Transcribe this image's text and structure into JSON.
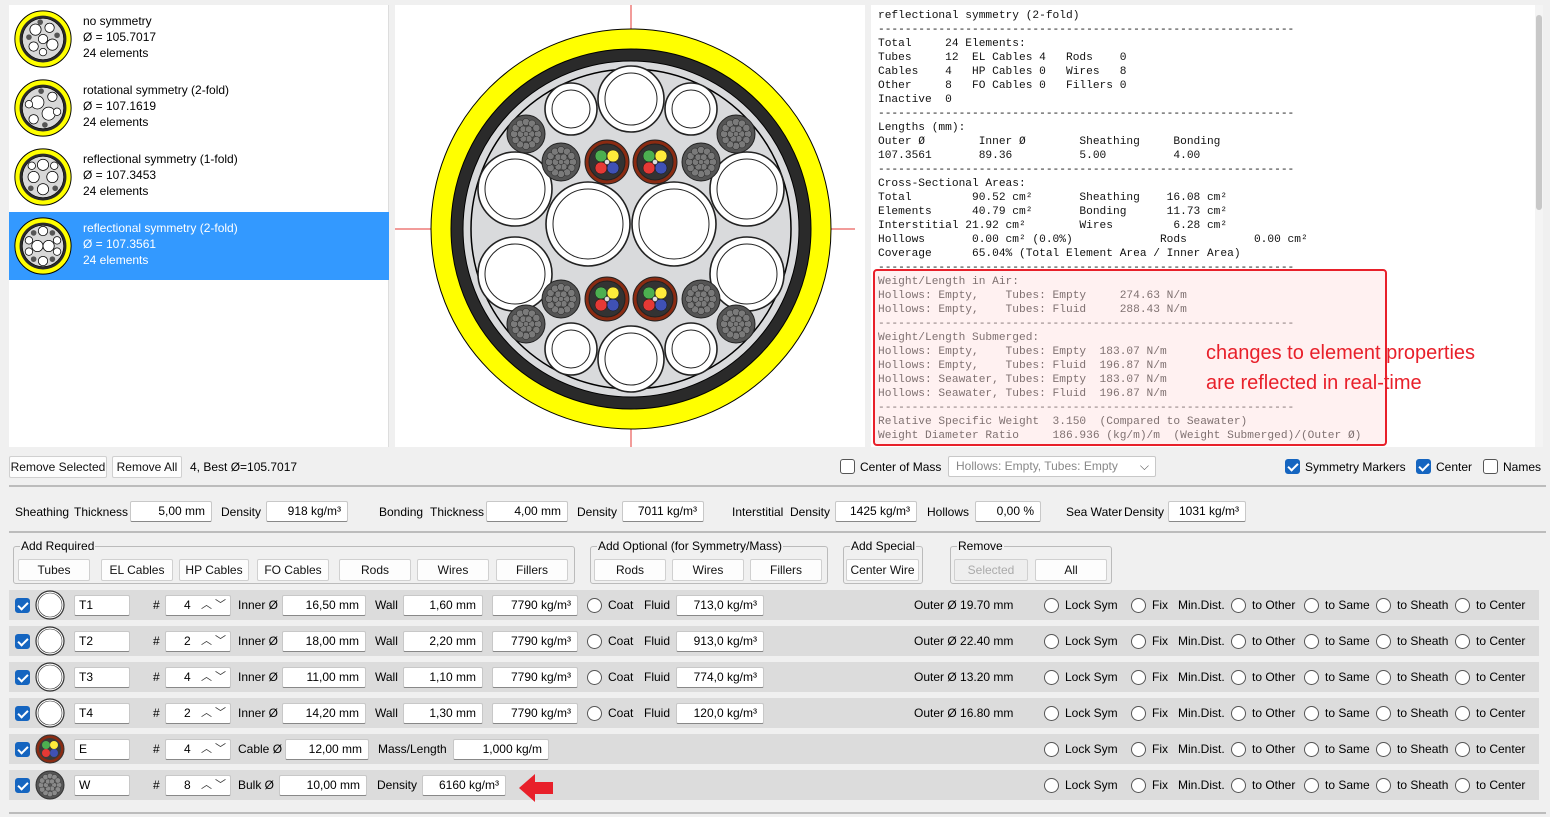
{
  "designs": [
    {
      "name": "no symmetry",
      "diameter": "Ø = 105.7017",
      "count": "24 elements"
    },
    {
      "name": "rotational symmetry (2-fold)",
      "diameter": "Ø = 107.1619",
      "count": "24 elements"
    },
    {
      "name": "reflectional symmetry (1-fold)",
      "diameter": "Ø = 107.3453",
      "count": "24 elements"
    },
    {
      "name": "reflectional symmetry (2-fold)",
      "diameter": "Ø = 107.3561",
      "count": "24 elements",
      "selected": true
    }
  ],
  "report": {
    "text": "reflectional symmetry (2-fold)\n--------------------------------------------------------------\nTotal     24 Elements:\nTubes     12  EL Cables 4   Rods    0\nCables    4   HP Cables 0   Wires   8\nOther     8   FO Cables 0   Fillers 0\nInactive  0\n--------------------------------------------------------------\nLengths (mm):\nOuter Ø        Inner Ø        Sheathing     Bonding\n107.3561       89.36          5.00          4.00\n--------------------------------------------------------------\nCross-Sectional Areas:\nTotal         90.52 cm²       Sheathing    16.08 cm²\nElements      40.79 cm²       Bonding      11.73 cm²\nInterstitial 21.92 cm²        Wires         6.28 cm²\nHollows       0.00 cm² (0.0%)             Rods          0.00 cm²\nCoverage      65.04% (Total Element Area / Inner Area)\n--------------------------------------------------------------\nWeight/Length in Air:\nHollows: Empty,    Tubes: Empty     274.63 N/m\nHollows: Empty,    Tubes: Fluid     288.43 N/m\n--------------------------------------------------------------\nWeight/Length Submerged:\nHollows: Empty,    Tubes: Empty  183.07 N/m\nHollows: Empty,    Tubes: Fluid  196.87 N/m\nHollows: Seawater, Tubes: Empty  183.07 N/m\nHollows: Seawater, Tubes: Fluid  196.87 N/m\n--------------------------------------------------------------\nRelative Specific Weight  3.150  (Compared to Seawater)\nWeight Diameter Ratio     186.936 (kg/m)/m  (Weight Submerged)/(Outer Ø)",
    "annotation_line1": "changes to element properties",
    "annotation_line2": "are reflected in real-time",
    "highlight_color": "#e8202a"
  },
  "toolbar": {
    "remove_selected": "Remove Selected",
    "remove_all": "Remove All",
    "best": "4, Best Ø=105.7017",
    "center_of_mass": "Center of Mass",
    "hollows_combo": "Hollows: Empty, Tubes: Empty",
    "symmetry_markers": "Symmetry Markers",
    "center": "Center",
    "names": "Names"
  },
  "props": {
    "sheathing": "Sheathing",
    "thickness": "Thickness",
    "sheathing_thickness": "5,00 mm",
    "density": "Density",
    "sheathing_density": "918 kg/m³",
    "bonding": "Bonding",
    "bonding_thickness": "4,00 mm",
    "bonding_density": "7011 kg/m³",
    "interstitial": "Interstitial",
    "interstitial_density": "1425 kg/m³",
    "hollows": "Hollows",
    "hollows_value": "0,00 %",
    "sea_water": "Sea Water",
    "sea_water_density": "1031 kg/m³"
  },
  "groups": {
    "required": {
      "title": "Add Required",
      "buttons": [
        "Tubes",
        "EL Cables",
        "HP Cables",
        "FO Cables",
        "Rods",
        "Wires",
        "Fillers"
      ]
    },
    "optional": {
      "title": "Add Optional (for Symmetry/Mass)",
      "buttons": [
        "Rods",
        "Wires",
        "Fillers"
      ]
    },
    "special": {
      "title": "Add Special",
      "buttons": [
        "Center Wire"
      ]
    },
    "remove": {
      "title": "Remove",
      "buttons": [
        "Selected",
        "All"
      ]
    }
  },
  "rowlabels": {
    "hash": "#",
    "inner": "Inner Ø",
    "wall": "Wall",
    "coat": "Coat",
    "fluid": "Fluid",
    "cable": "Cable Ø",
    "mass": "Mass/Length",
    "bulk": "Bulk Ø",
    "density": "Density",
    "lock": "Lock Sym",
    "fix": "Fix",
    "mindist": "Min.Dist.",
    "to_other": "to Other",
    "to_same": "to Same",
    "to_sheath": "to Sheath",
    "to_center": "to Center"
  },
  "rows": [
    {
      "name": "T1",
      "count": "4",
      "kind": "tube",
      "inner": "16,50 mm",
      "wall": "1,60 mm",
      "mat": "7790 kg/m³",
      "fluid": "713,0 kg/m³",
      "outer": "Outer Ø 19.70 mm"
    },
    {
      "name": "T2",
      "count": "2",
      "kind": "tube",
      "inner": "18,00 mm",
      "wall": "2,20 mm",
      "mat": "7790 kg/m³",
      "fluid": "913,0 kg/m³",
      "outer": "Outer Ø 22.40 mm"
    },
    {
      "name": "T3",
      "count": "4",
      "kind": "tube",
      "inner": "11,00 mm",
      "wall": "1,10 mm",
      "mat": "7790 kg/m³",
      "fluid": "774,0 kg/m³",
      "outer": "Outer Ø 13.20 mm"
    },
    {
      "name": "T4",
      "count": "2",
      "kind": "tube",
      "inner": "14,20 mm",
      "wall": "1,30 mm",
      "mat": "7790 kg/m³",
      "fluid": "120,0 kg/m³",
      "outer": "Outer Ø 16.80 mm"
    },
    {
      "name": "E",
      "count": "4",
      "kind": "cable",
      "cable": "12,00 mm",
      "mass": "1,000 kg/m"
    },
    {
      "name": "W",
      "count": "8",
      "kind": "wire",
      "bulk": "10,00 mm",
      "density": "6160 kg/m³"
    }
  ]
}
